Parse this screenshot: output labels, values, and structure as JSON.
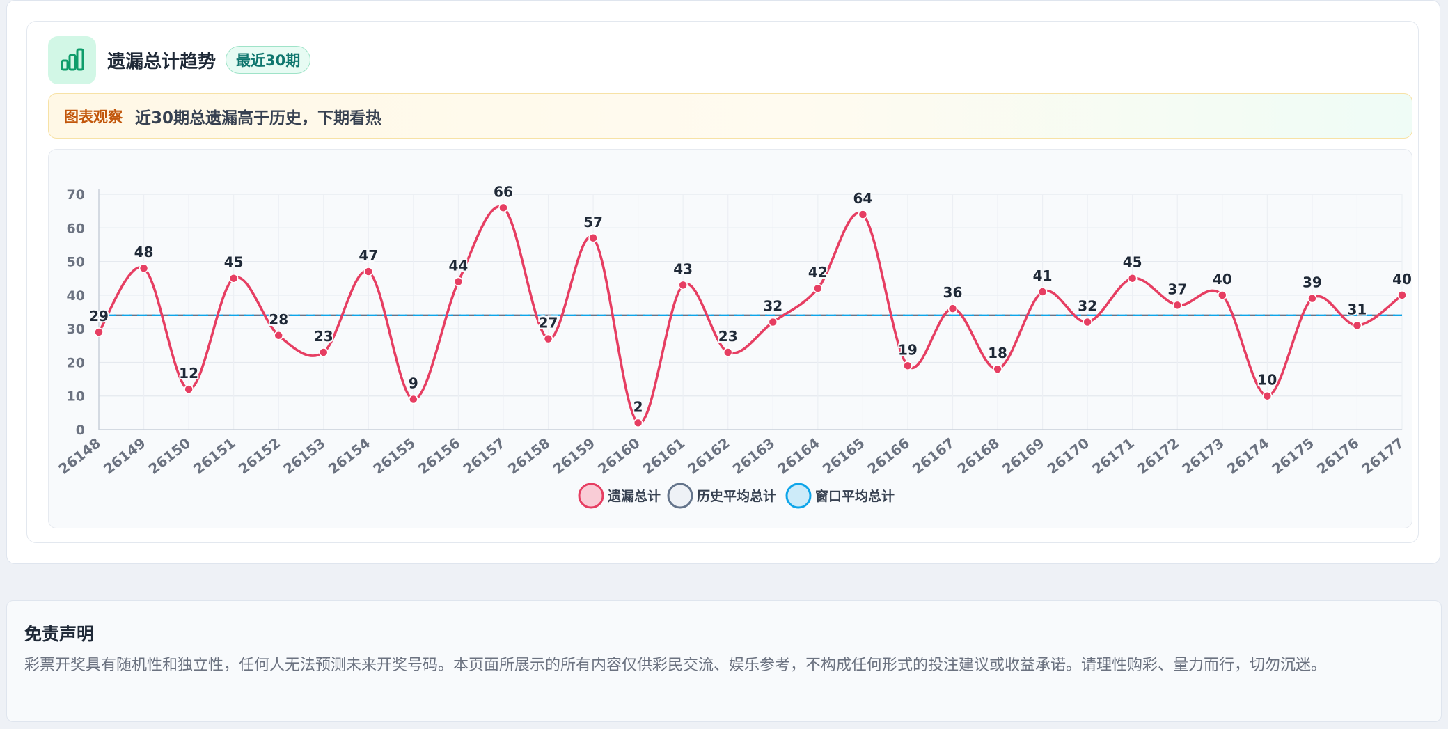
{
  "panel": {
    "title": "遗漏总计趋势",
    "badge": "最近30期",
    "observation_label": "图表观察",
    "observation_text": "近30期总遗漏高于历史，下期看热"
  },
  "icons": {
    "header": "bar-chart-icon"
  },
  "colors": {
    "series_main": "#e63e62",
    "series_hist": "#64748b",
    "series_window": "#0ea5e9",
    "accent_green": "#0f9d6b",
    "observe_label": "#c2570c"
  },
  "chart_data": {
    "type": "line",
    "title": "",
    "xlabel": "",
    "ylabel": "",
    "ylim": [
      0,
      70
    ],
    "yticks": [
      0,
      10,
      20,
      30,
      40,
      50,
      60,
      70
    ],
    "grid": true,
    "legend_position": "bottom",
    "x": [
      "26148",
      "26149",
      "26150",
      "26151",
      "26152",
      "26153",
      "26154",
      "26155",
      "26156",
      "26157",
      "26158",
      "26159",
      "26160",
      "26161",
      "26162",
      "26163",
      "26164",
      "26165",
      "26166",
      "26167",
      "26168",
      "26169",
      "26170",
      "26171",
      "26172",
      "26173",
      "26174",
      "26175",
      "26176",
      "26177"
    ],
    "series": [
      {
        "name": "遗漏总计",
        "style": "smooth-line",
        "data_labels": true,
        "values": [
          29,
          48,
          12,
          45,
          28,
          23,
          47,
          9,
          44,
          66,
          27,
          57,
          2,
          43,
          23,
          32,
          42,
          64,
          19,
          36,
          18,
          41,
          32,
          45,
          37,
          40,
          10,
          39,
          31,
          40
        ]
      },
      {
        "name": "历史平均总计",
        "style": "dashed-line",
        "values": [
          34,
          34,
          34,
          34,
          34,
          34,
          34,
          34,
          34,
          34,
          34,
          34,
          34,
          34,
          34,
          34,
          34,
          34,
          34,
          34,
          34,
          34,
          34,
          34,
          34,
          34,
          34,
          34,
          34,
          34
        ]
      },
      {
        "name": "窗口平均总计",
        "style": "dashed-line",
        "values": [
          34,
          34,
          34,
          34,
          34,
          34,
          34,
          34,
          34,
          34,
          34,
          34,
          34,
          34,
          34,
          34,
          34,
          34,
          34,
          34,
          34,
          34,
          34,
          34,
          34,
          34,
          34,
          34,
          34,
          34
        ]
      }
    ]
  },
  "disclaimer": {
    "title": "免责声明",
    "text": "彩票开奖具有随机性和独立性，任何人无法预测未来开奖号码。本页面所展示的所有内容仅供彩民交流、娱乐参考，不构成任何形式的投注建议或收益承诺。请理性购彩、量力而行，切勿沉迷。"
  }
}
